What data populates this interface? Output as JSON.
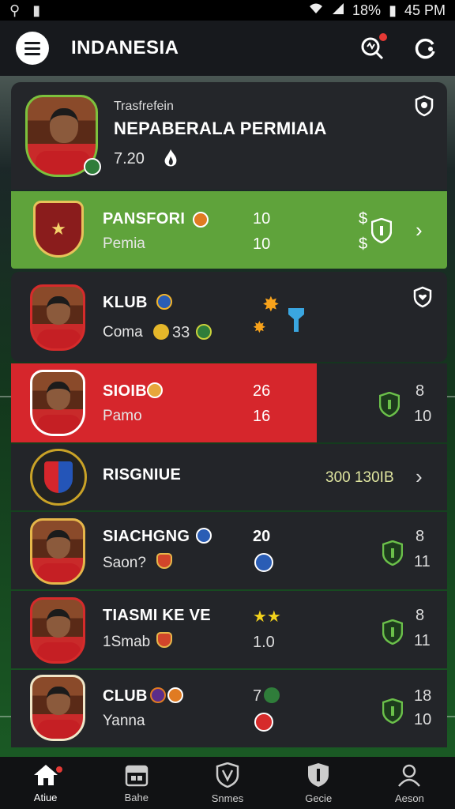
{
  "status_bar": {
    "left_icons": [
      "location-icon",
      "image-icon"
    ],
    "battery": "18%",
    "time": "45 PM"
  },
  "app": {
    "title": "INDANESIA"
  },
  "hero": {
    "kicker": "Trasfrefein",
    "title": "NEPABERALA PERMIAIA",
    "value": "7.20"
  },
  "rows": [
    {
      "name": "PANSFORI",
      "sub": "Pemia",
      "n1": "10",
      "n2": "10",
      "extra1": "$",
      "extra2": "$",
      "style": "green"
    },
    {
      "name": "KLUB",
      "sub": "Coma",
      "sub_num": "33",
      "style": "dark"
    },
    {
      "name": "SIOIB",
      "sub": "Pamo",
      "n1": "26",
      "n2": "16",
      "right1": "8",
      "right2": "10",
      "style": "red"
    },
    {
      "name": "RISGNIUE",
      "stat": "300 130IB",
      "style": "dark"
    },
    {
      "name": "SIACHGNG",
      "sub": "Saon?",
      "n1": "20",
      "right1": "8",
      "right2": "11",
      "style": "dark"
    },
    {
      "name": "TIASMI KE VE",
      "sub": "1Smab",
      "n2": "1.0",
      "right1": "8",
      "right2": "11",
      "style": "dark"
    },
    {
      "name": "CLUB",
      "sub": "Yanna",
      "n1": "7",
      "right1": "18",
      "right2": "10",
      "style": "dark"
    }
  ],
  "nav": [
    {
      "label": "Atiue",
      "icon": "home-icon"
    },
    {
      "label": "Bahe",
      "icon": "calendar-icon"
    },
    {
      "label": "Snmes",
      "icon": "shield-icon"
    },
    {
      "label": "Gecie",
      "icon": "badge-icon"
    },
    {
      "label": "Aeson",
      "icon": "profile-icon"
    }
  ],
  "colors": {
    "green": "#5fa33b",
    "red": "#d6262c",
    "dark": "#232529",
    "header": "#17191d"
  }
}
